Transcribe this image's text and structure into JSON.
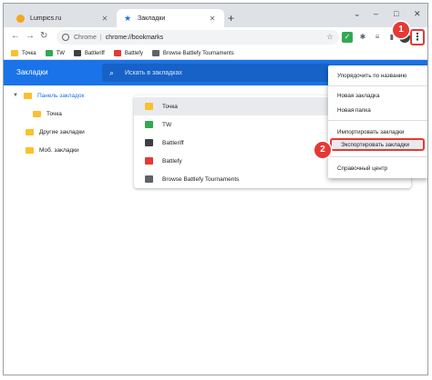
{
  "tabs": [
    {
      "title": "Lumpics.ru",
      "favicon_color": "#f5a623"
    },
    {
      "title": "Закладки",
      "favicon_color": "#1a73e8"
    }
  ],
  "window_controls": {
    "minimize": "–",
    "maximize": "□",
    "close": "✕",
    "tabs_dropdown": "⌄"
  },
  "omnibox": {
    "scheme_label": "Chrome",
    "separator": "|",
    "url": "chrome://bookmarks"
  },
  "bookmarks_bar": [
    {
      "label": "Точка",
      "icon": "folder-icon",
      "color": "#fbc02d"
    },
    {
      "label": "TW",
      "icon": "tw-icon",
      "color": "#34a853"
    },
    {
      "label": "Battleriff",
      "icon": "battleriff-icon",
      "color": "#3c4043"
    },
    {
      "label": "Battlefy",
      "icon": "battlefy-icon",
      "color": "#e53935"
    },
    {
      "label": "Browse Battlefy Tournaments",
      "icon": "battlefy-icon",
      "color": "#5f6368"
    }
  ],
  "manager": {
    "title": "Закладки",
    "search_placeholder": "Искать в закладках"
  },
  "tree": [
    {
      "label": "Панель закладок",
      "selected": true
    },
    {
      "label": "Точка"
    },
    {
      "label": "Другие закладки"
    },
    {
      "label": "Моб. закладки"
    }
  ],
  "list": [
    {
      "label": "Точка",
      "icon": "folder-icon",
      "color": "#fbc02d"
    },
    {
      "label": "TW",
      "icon": "tw-icon",
      "color": "#34a853"
    },
    {
      "label": "Battleriff",
      "icon": "battleriff-icon",
      "color": "#3c4043"
    },
    {
      "label": "Battlefy",
      "icon": "battlefy-icon",
      "color": "#e53935"
    },
    {
      "label": "Browse Battlefy Tournaments",
      "icon": "battlefy-icon",
      "color": "#5f6368"
    }
  ],
  "menu": {
    "sort_by_name": "Упорядочить по названию",
    "new_bookmark": "Новая закладка",
    "new_folder": "Новая папка",
    "import": "Импортировать закладки",
    "export": "Экспортировать закладки",
    "help": "Справочный центр"
  },
  "badges": {
    "step1": "1",
    "step2": "2"
  },
  "colors": {
    "accent": "#1a73e8",
    "highlight": "#e53935"
  }
}
